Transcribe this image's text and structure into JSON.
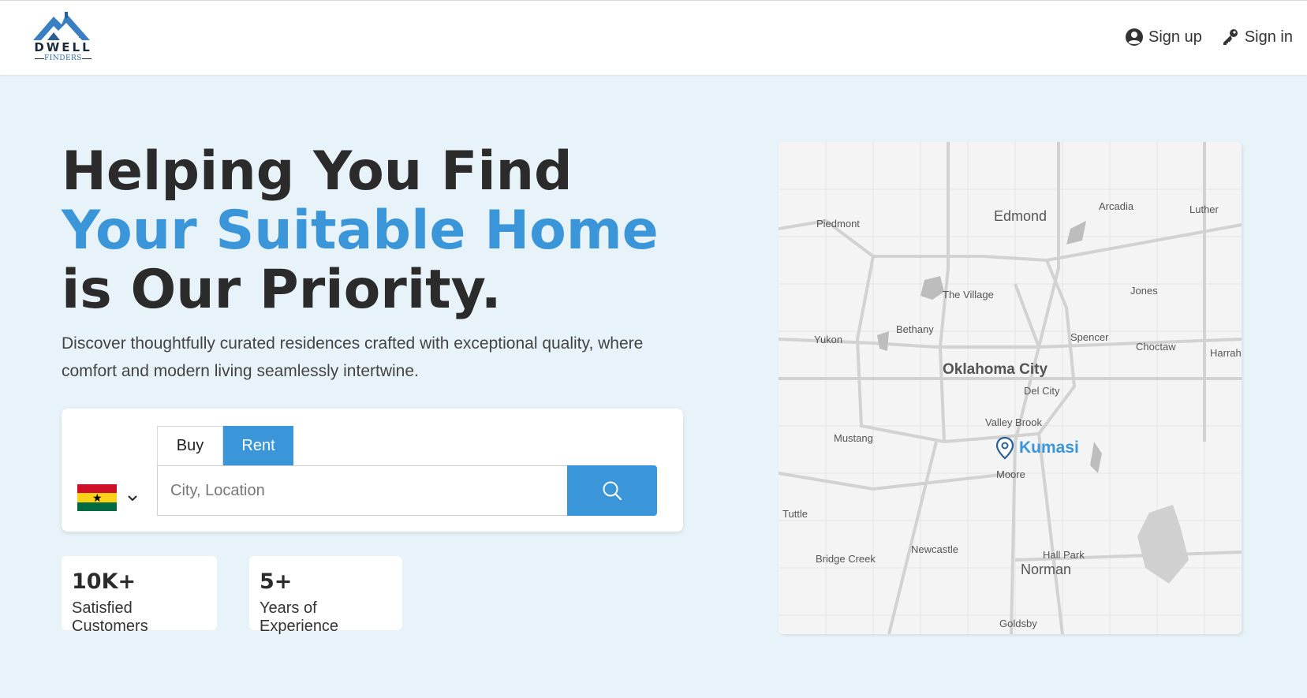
{
  "brand": {
    "name": "DWELL",
    "sub": "FINDERS",
    "color": "#3a96d9"
  },
  "nav": {
    "signup": {
      "label": "Sign up",
      "icon": "user-circle-icon"
    },
    "signin": {
      "label": "Sign in",
      "icon": "key-icon"
    }
  },
  "hero": {
    "line1": "Helping You Find",
    "line2": "Your Suitable Home",
    "line3": "is Our Priority.",
    "description": "Discover thoughtfully curated residences crafted with exceptional quality, where comfort and modern living seamlessly intertwine."
  },
  "search": {
    "country": "Ghana",
    "tabs": [
      "Buy",
      "Rent"
    ],
    "active_tab": "Rent",
    "placeholder": "City, Location",
    "value": ""
  },
  "stats": [
    {
      "value": "10K+",
      "label": "Satisfied Customers"
    },
    {
      "value": "5+",
      "label": "Years of Experience"
    }
  ],
  "map": {
    "marker_label": "Kumasi",
    "places": {
      "edmond": "Edmond",
      "arcadia": "Arcadia",
      "luther": "Luther",
      "piedmont": "Piedmont",
      "the_village": "The Village",
      "jones": "Jones",
      "bethany": "Bethany",
      "yukon": "Yukon",
      "spencer": "Spencer",
      "choctaw": "Choctaw",
      "harrah": "Harrah",
      "oklahoma_city": "Oklahoma City",
      "del_city": "Del City",
      "valley_brook": "Valley Brook",
      "mustang": "Mustang",
      "moore": "Moore",
      "tuttle": "Tuttle",
      "newcastle": "Newcastle",
      "bridge_creek": "Bridge Creek",
      "hall_park": "Hall Park",
      "norman": "Norman",
      "goldsby": "Goldsby"
    }
  }
}
